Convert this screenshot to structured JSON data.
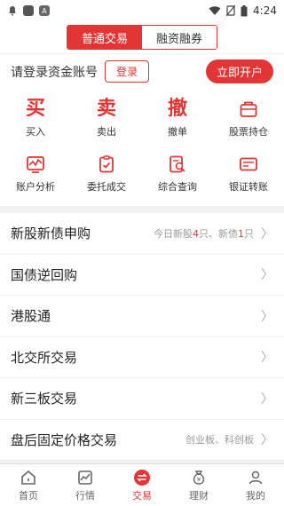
{
  "status": {
    "time": "4:24"
  },
  "tabs": [
    {
      "label": "普通交易"
    },
    {
      "label": "融资融券"
    }
  ],
  "login": {
    "prompt": "请登录资金账号",
    "login_label": "登录",
    "open_label": "立即开户"
  },
  "grid": {
    "row1": [
      {
        "big": "买",
        "label": "买入"
      },
      {
        "big": "卖",
        "label": "卖出"
      },
      {
        "big": "撤",
        "label": "撤单"
      },
      {
        "label": "股票持仓"
      }
    ],
    "row2": [
      {
        "label": "账户分析"
      },
      {
        "label": "委托成交"
      },
      {
        "label": "综合查询"
      },
      {
        "label": "银证转账"
      }
    ]
  },
  "list": [
    {
      "title": "新股新债申购",
      "hint_prefix": "今日新股",
      "stock_count": "4",
      "hint_mid": "只、新债",
      "bond_count": "1",
      "hint_suffix": "只"
    },
    {
      "title": "国债逆回购"
    },
    {
      "title": "港股通"
    },
    {
      "title": "北交所交易"
    },
    {
      "title": "新三板交易"
    },
    {
      "title": "盘后固定价格交易",
      "hint": "创业板、科创板"
    }
  ],
  "nav": [
    {
      "label": "首页",
      "icon": "home-icon"
    },
    {
      "label": "行情",
      "icon": "chart-icon"
    },
    {
      "label": "交易",
      "icon": "trade-icon"
    },
    {
      "label": "理财",
      "icon": "money-bag-icon"
    },
    {
      "label": "我的",
      "icon": "user-icon"
    }
  ],
  "colors": {
    "accent": "#e23535"
  }
}
